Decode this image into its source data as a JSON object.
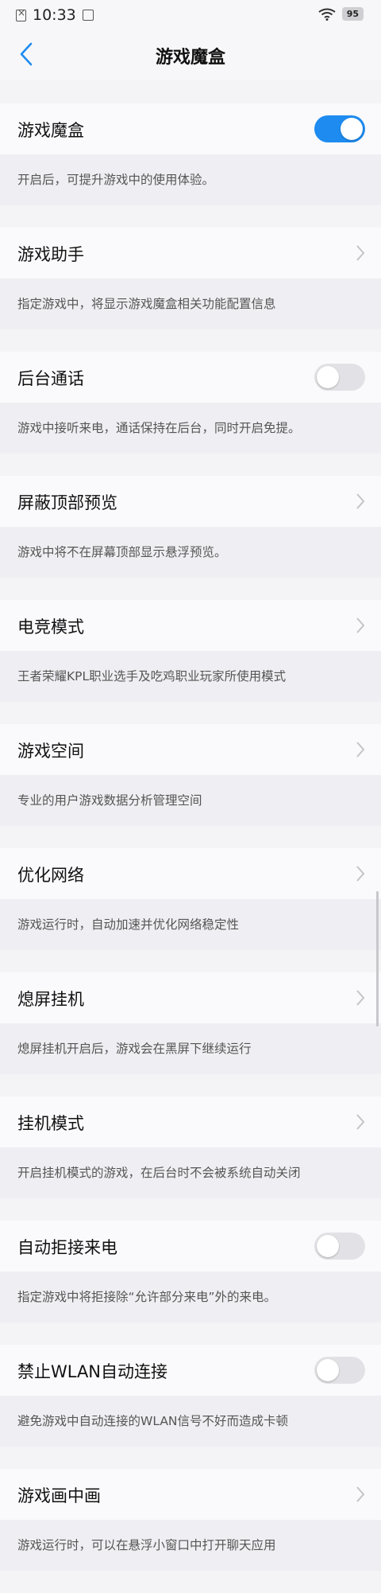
{
  "status_bar": {
    "time": "10:33",
    "battery": "95",
    "icons": [
      "sim-icon",
      "notification-icon",
      "wifi-icon",
      "battery-icon"
    ]
  },
  "header": {
    "title": "游戏魔盒"
  },
  "colors": {
    "accent": "#1e8bf0",
    "toggle_off": "#e2e2e6"
  },
  "settings": [
    {
      "label": "游戏魔盒",
      "control": "toggle",
      "on": true,
      "desc": "开启后，可提升游戏中的使用体验。"
    },
    {
      "label": "游戏助手",
      "control": "chevron",
      "desc": "指定游戏中，将显示游戏魔盒相关功能配置信息"
    },
    {
      "label": "后台通话",
      "control": "toggle",
      "on": false,
      "desc": "游戏中接听来电，通话保持在后台，同时开启免提。"
    },
    {
      "label": "屏蔽顶部预览",
      "control": "chevron",
      "desc": "游戏中将不在屏幕顶部显示悬浮预览。"
    },
    {
      "label": "电竞模式",
      "control": "chevron",
      "desc": "王者荣耀KPL职业选手及吃鸡职业玩家所使用模式"
    },
    {
      "label": "游戏空间",
      "control": "chevron",
      "desc": "专业的用户游戏数据分析管理空间"
    },
    {
      "label": "优化网络",
      "control": "chevron",
      "desc": "游戏运行时，自动加速并优化网络稳定性"
    },
    {
      "label": "熄屏挂机",
      "control": "chevron",
      "desc": "熄屏挂机开启后，游戏会在黑屏下继续运行"
    },
    {
      "label": "挂机模式",
      "control": "chevron",
      "desc": "开启挂机模式的游戏，在后台时不会被系统自动关闭"
    },
    {
      "label": "自动拒接来电",
      "control": "toggle",
      "on": false,
      "desc": "指定游戏中将拒接除“允许部分来电”外的来电。"
    },
    {
      "label": "禁止WLAN自动连接",
      "control": "toggle",
      "on": false,
      "desc": "避免游戏中自动连接的WLAN信号不好而造成卡顿"
    },
    {
      "label": "游戏画中画",
      "control": "chevron",
      "desc": "游戏运行时，可以在悬浮小窗口中打开聊天应用"
    }
  ]
}
